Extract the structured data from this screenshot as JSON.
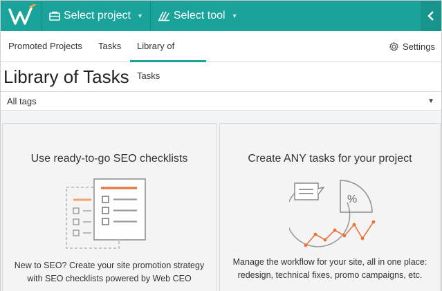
{
  "header": {
    "select_project_label": "Select project",
    "select_tool_label": "Select tool"
  },
  "tabs": [
    {
      "label": "Promoted Projects"
    },
    {
      "label": "Tasks"
    },
    {
      "label": "Library of Tasks",
      "active": true
    }
  ],
  "settings_label": "Settings",
  "page_title": "Library of Tasks",
  "tags_filter": {
    "selected": "All tags"
  },
  "cards": [
    {
      "title": "Use ready-to-go SEO checklists",
      "desc_line1": "New to SEO? Create your site promotion strategy",
      "desc_line2": "with SEO checklists powered by Web CEO"
    },
    {
      "title": "Create ANY tasks for your project",
      "desc_line1": "Manage the workflow for your site, all in one place:",
      "desc_line2": "redesign, technical fixes, promo campaigns, etc."
    }
  ],
  "illustration_percent": "%",
  "colors": {
    "brand_teal": "#1aa39a",
    "accent_orange": "#e8743b"
  },
  "icons": [
    "webceo-logo-icon",
    "briefcase-icon",
    "tools-icon",
    "chevron-left-icon",
    "gear-icon",
    "chevron-down-icon"
  ]
}
